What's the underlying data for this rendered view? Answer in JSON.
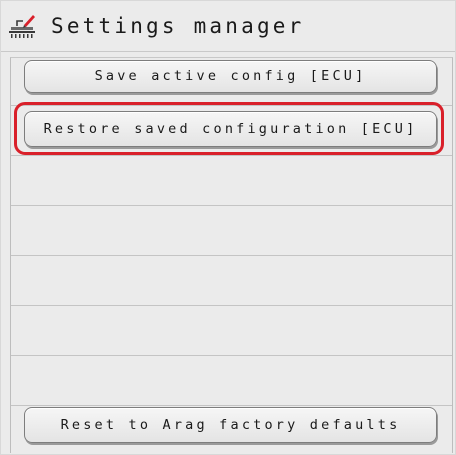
{
  "window": {
    "title": "Settings manager",
    "title_icon": "sprayer-settings-icon"
  },
  "actions": {
    "save_label": "Save active config [ECU]",
    "restore_label": "Restore saved configuration [ECU]",
    "reset_label": "Reset to Arag factory defaults"
  },
  "highlight": {
    "target": "restore",
    "color": "#d9202a"
  }
}
